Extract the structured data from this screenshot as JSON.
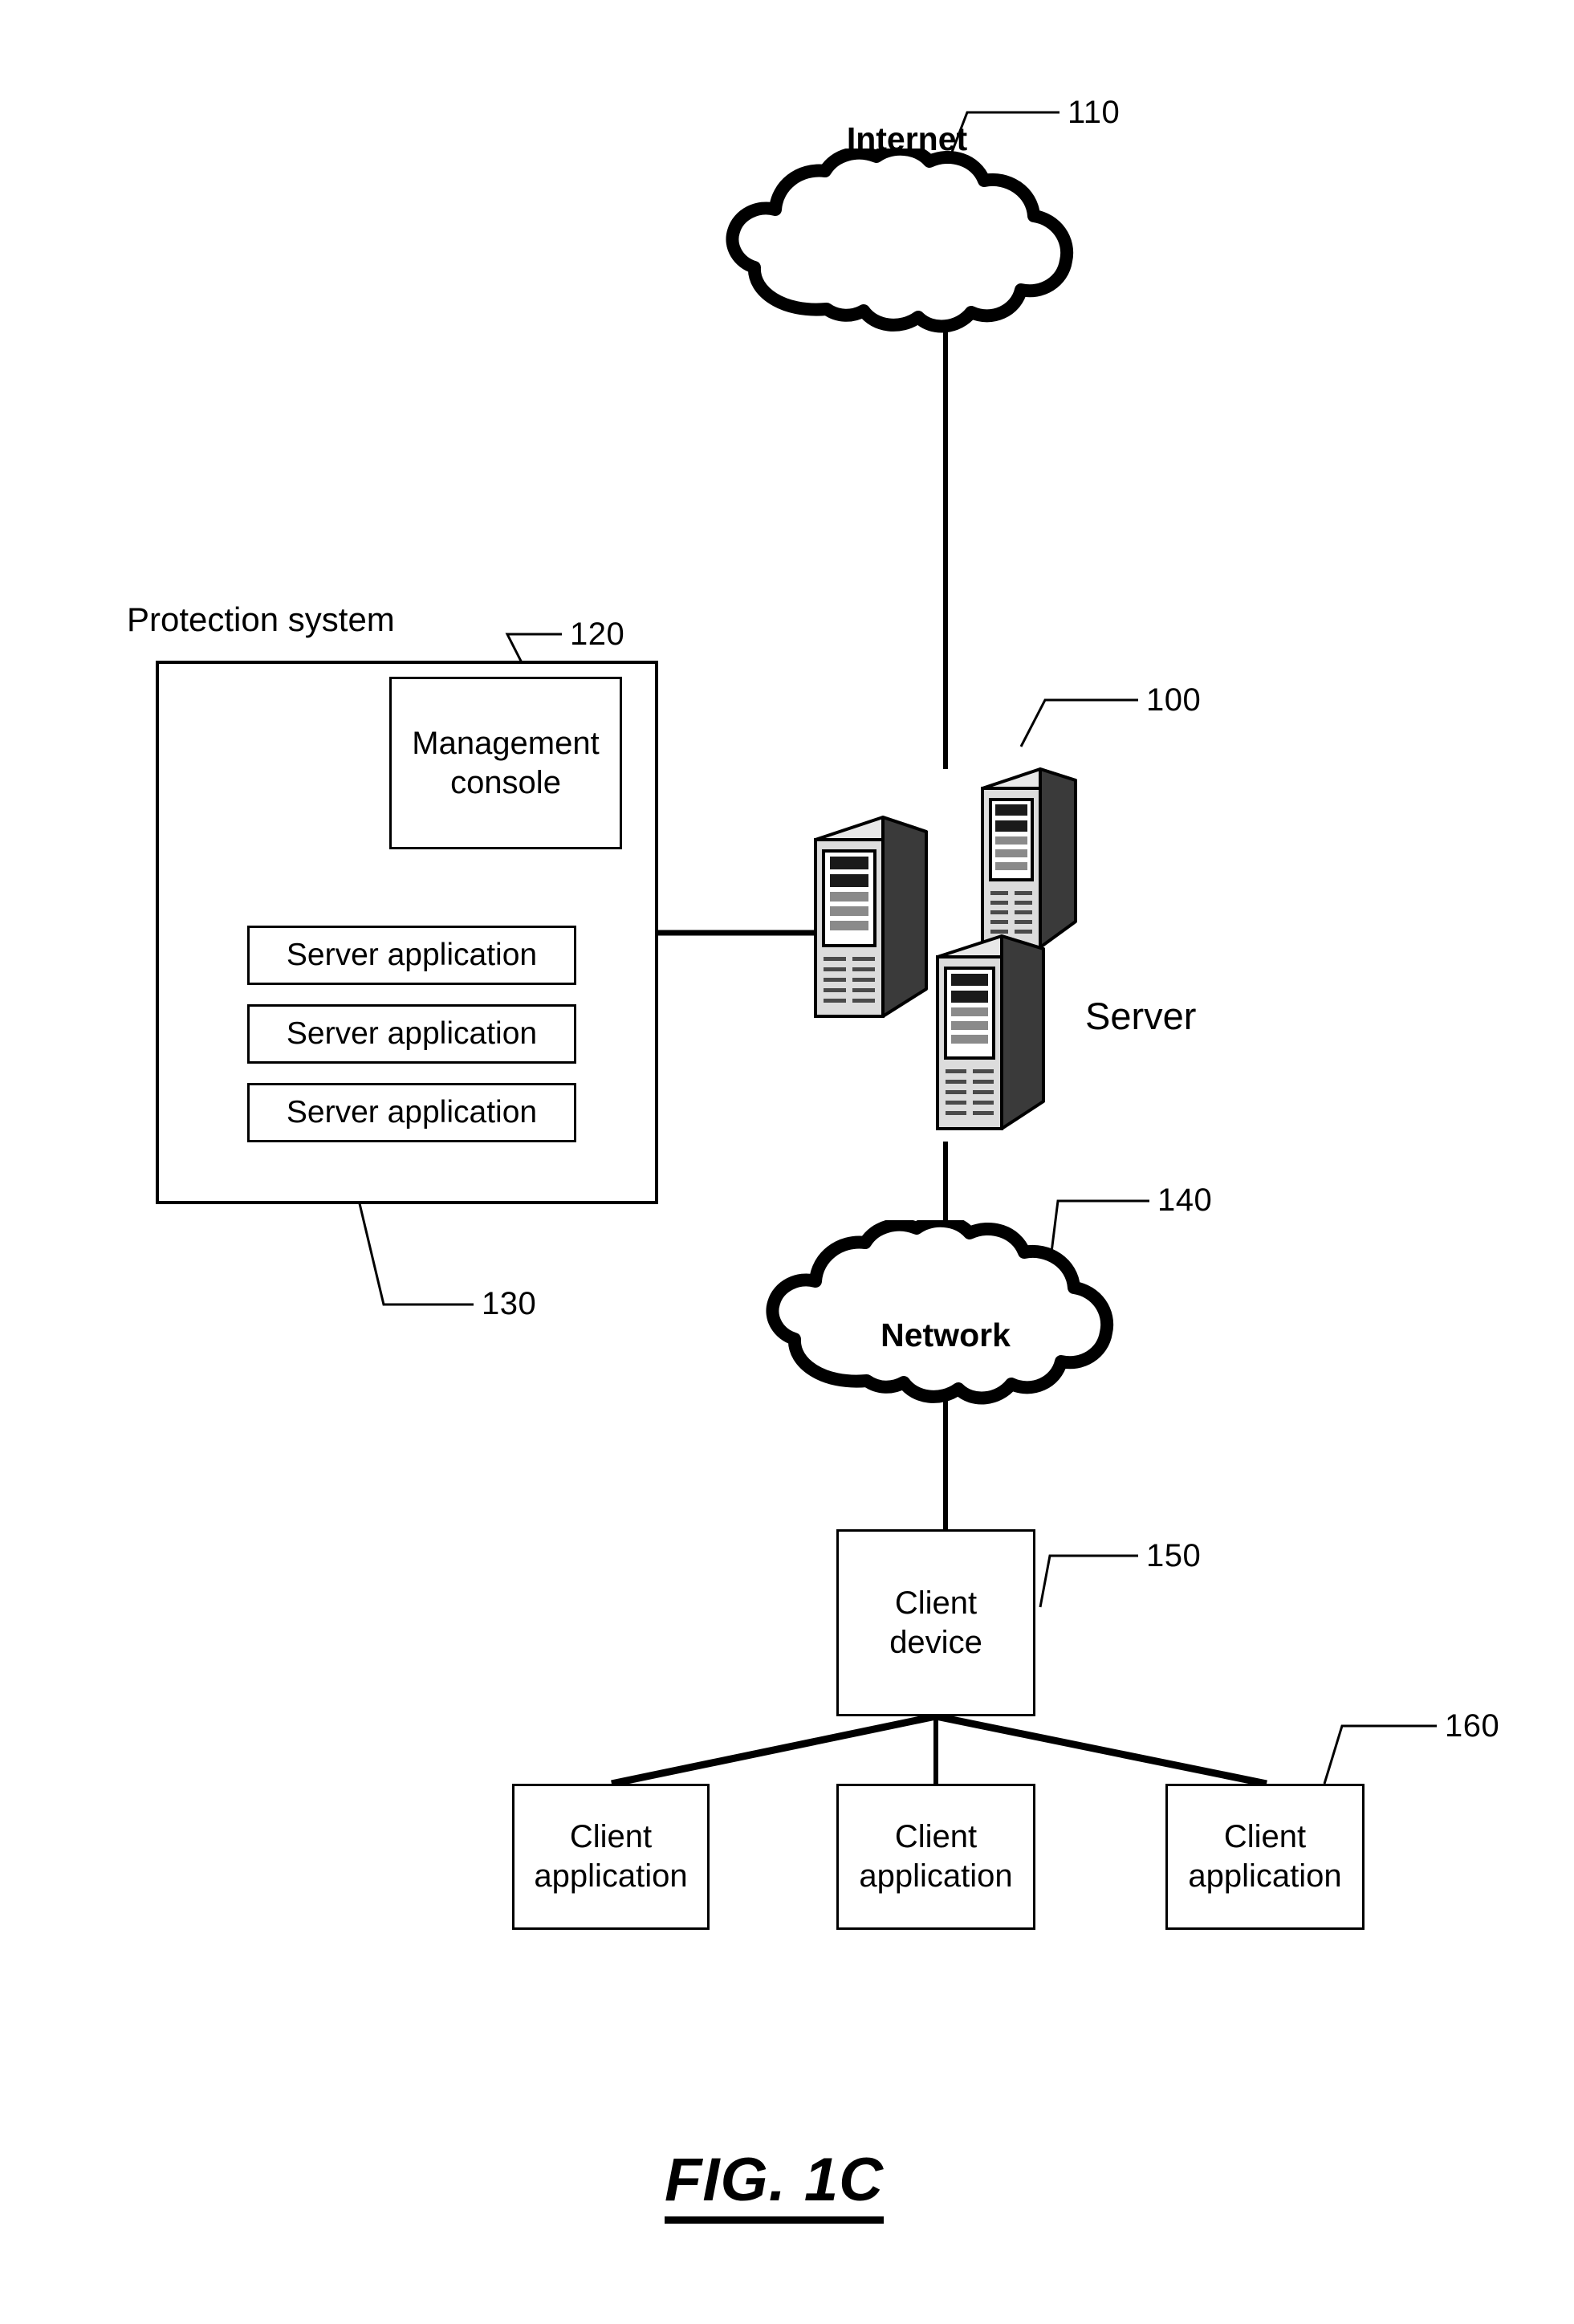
{
  "figure": {
    "caption": "FIG. 1C",
    "title_label": "Protection system"
  },
  "nodes": {
    "internet_cloud": {
      "label": "Internet",
      "ref": "110",
      "icon": "cloud-icon"
    },
    "protection_system": {
      "label": "Protection system",
      "ref": "120",
      "management_console": {
        "label": "Management console",
        "ref": "120"
      },
      "server_applications_ref": "130",
      "server_applications": [
        {
          "label": "Server application"
        },
        {
          "label": "Server application"
        },
        {
          "label": "Server application"
        }
      ]
    },
    "server_cluster": {
      "label": "Server",
      "ref": "100",
      "icon": "server-tower-icon",
      "tower_count": 3
    },
    "network_cloud": {
      "label": "Network",
      "ref": "140",
      "icon": "cloud-icon"
    },
    "client_device": {
      "label": "Client device",
      "ref": "150"
    },
    "client_applications_ref": "160",
    "client_applications": [
      {
        "label": "Client application"
      },
      {
        "label": "Client application"
      },
      {
        "label": "Client application"
      }
    ]
  },
  "colors": {
    "ink": "#000000",
    "paper": "#ffffff"
  }
}
